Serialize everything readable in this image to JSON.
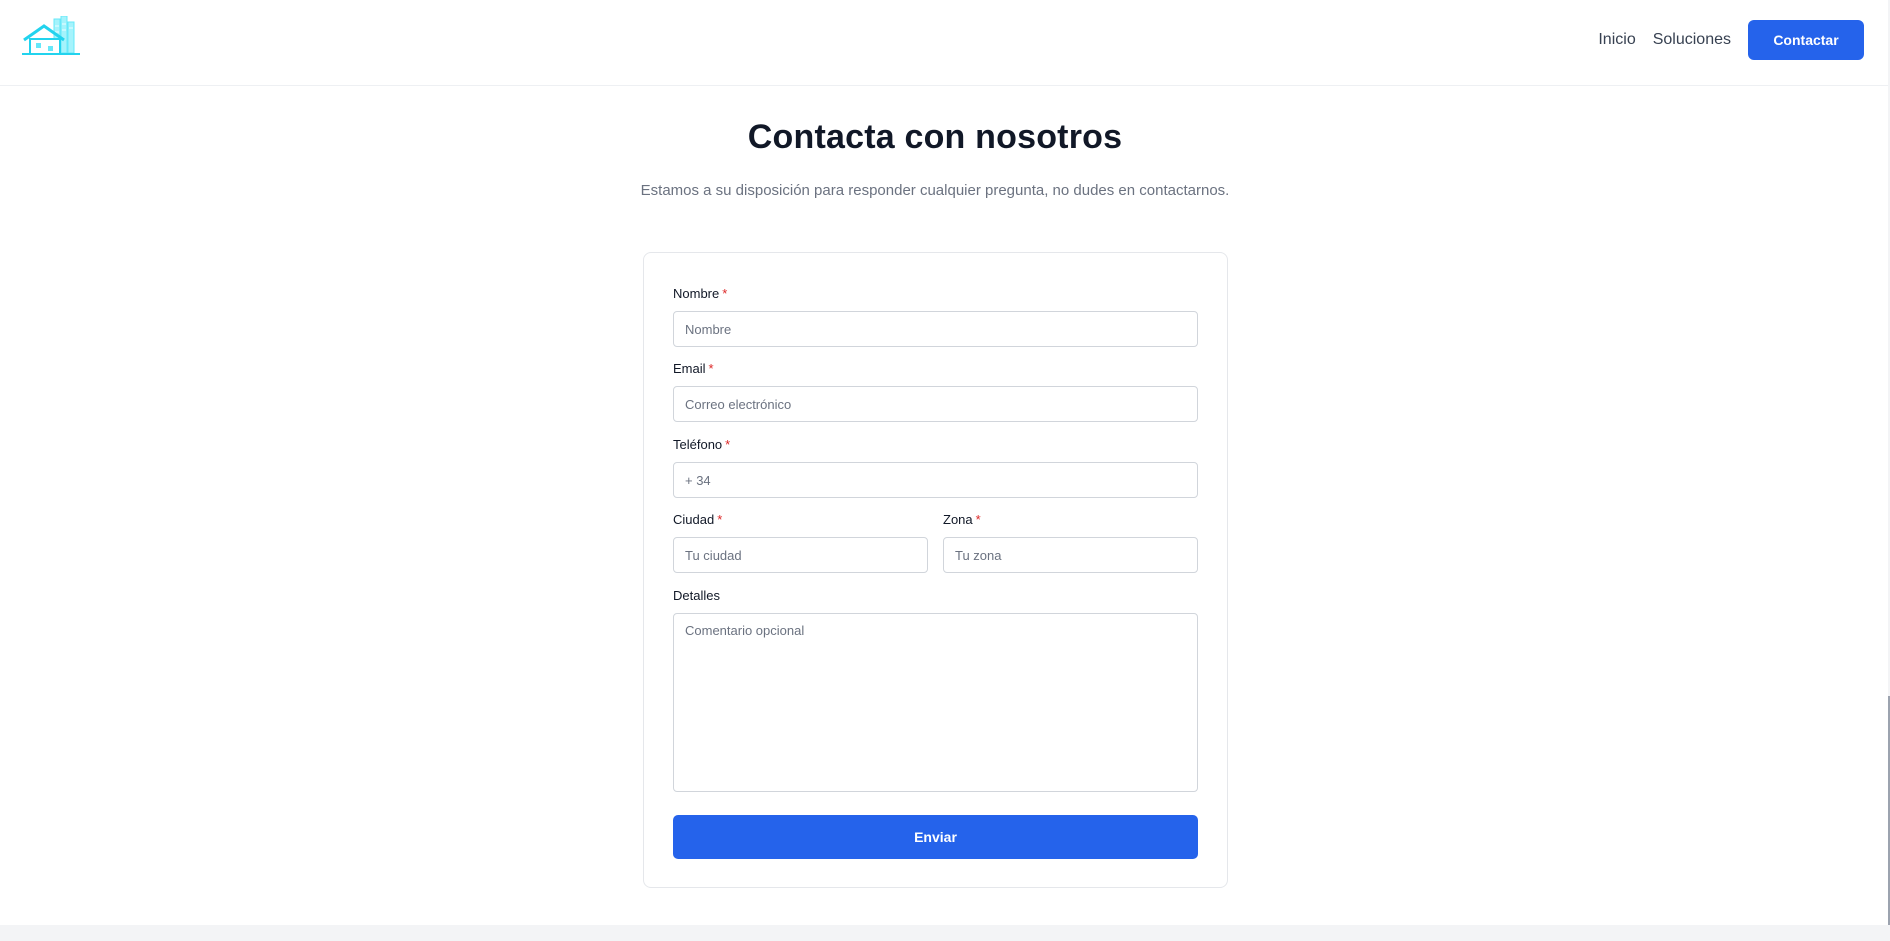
{
  "header": {
    "logo_icon": "house-buildings-logo",
    "nav": [
      "Inicio",
      "Soluciones"
    ],
    "cta_label": "Contactar"
  },
  "hero": {
    "title": "Contacta con nosotros",
    "subtitle": "Estamos a su disposición para responder cualquier pregunta, no dudes en contactarnos."
  },
  "form": {
    "required_mark": "*",
    "fields": {
      "nombre": {
        "label": "Nombre",
        "placeholder": "Nombre"
      },
      "email": {
        "label": "Email",
        "placeholder": "Correo electrónico"
      },
      "telefono": {
        "label": "Teléfono",
        "placeholder": "+ 34"
      },
      "ciudad": {
        "label": "Ciudad",
        "placeholder": "Tu ciudad"
      },
      "zona": {
        "label": "Zona",
        "placeholder": "Tu zona"
      },
      "detalles": {
        "label": "Detalles",
        "placeholder": "Comentario opcional"
      }
    },
    "submit_label": "Enviar"
  },
  "colors": {
    "accent": "#2563eb",
    "logo": "#67e8f9",
    "required": "#dc2626"
  }
}
